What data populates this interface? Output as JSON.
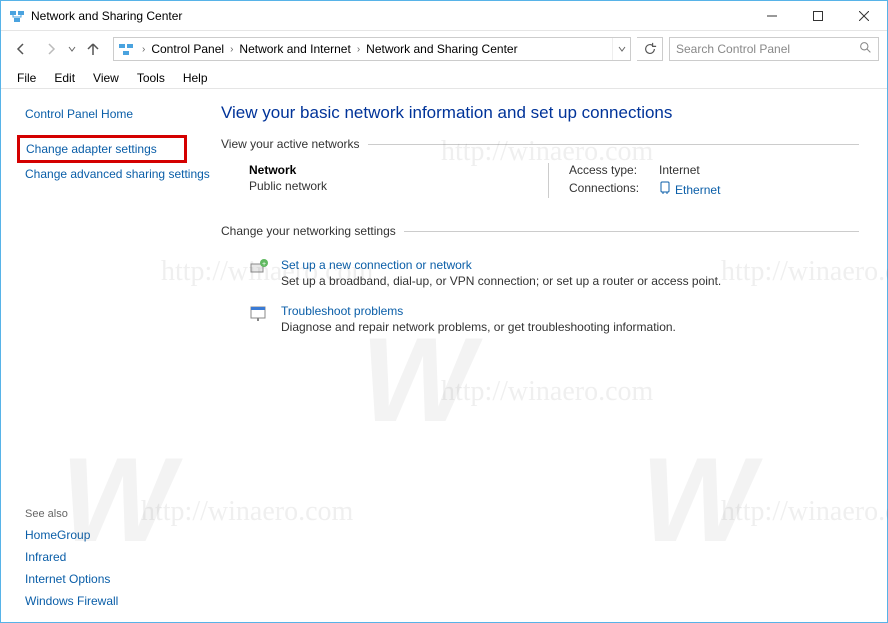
{
  "window": {
    "title": "Network and Sharing Center"
  },
  "breadcrumb": {
    "items": [
      "Control Panel",
      "Network and Internet",
      "Network and Sharing Center"
    ]
  },
  "search": {
    "placeholder": "Search Control Panel"
  },
  "menu": {
    "items": [
      "File",
      "Edit",
      "View",
      "Tools",
      "Help"
    ]
  },
  "sidebar": {
    "home": "Control Panel Home",
    "adapter": "Change adapter settings",
    "advanced": "Change advanced sharing settings",
    "see_also_head": "See also",
    "see_also": [
      "HomeGroup",
      "Infrared",
      "Internet Options",
      "Windows Firewall"
    ]
  },
  "main": {
    "title": "View your basic network information and set up connections",
    "active_head": "View your active networks",
    "network": {
      "name": "Network",
      "type": "Public network"
    },
    "props": {
      "access_k": "Access type:",
      "access_v": "Internet",
      "conn_k": "Connections:",
      "conn_v": "Ethernet"
    },
    "change_head": "Change your networking settings",
    "items": [
      {
        "title": "Set up a new connection or network",
        "desc": "Set up a broadband, dial-up, or VPN connection; or set up a router or access point."
      },
      {
        "title": "Troubleshoot problems",
        "desc": "Diagnose and repair network problems, or get troubleshooting information."
      }
    ]
  },
  "watermark": {
    "text": "http://winaero.com"
  }
}
